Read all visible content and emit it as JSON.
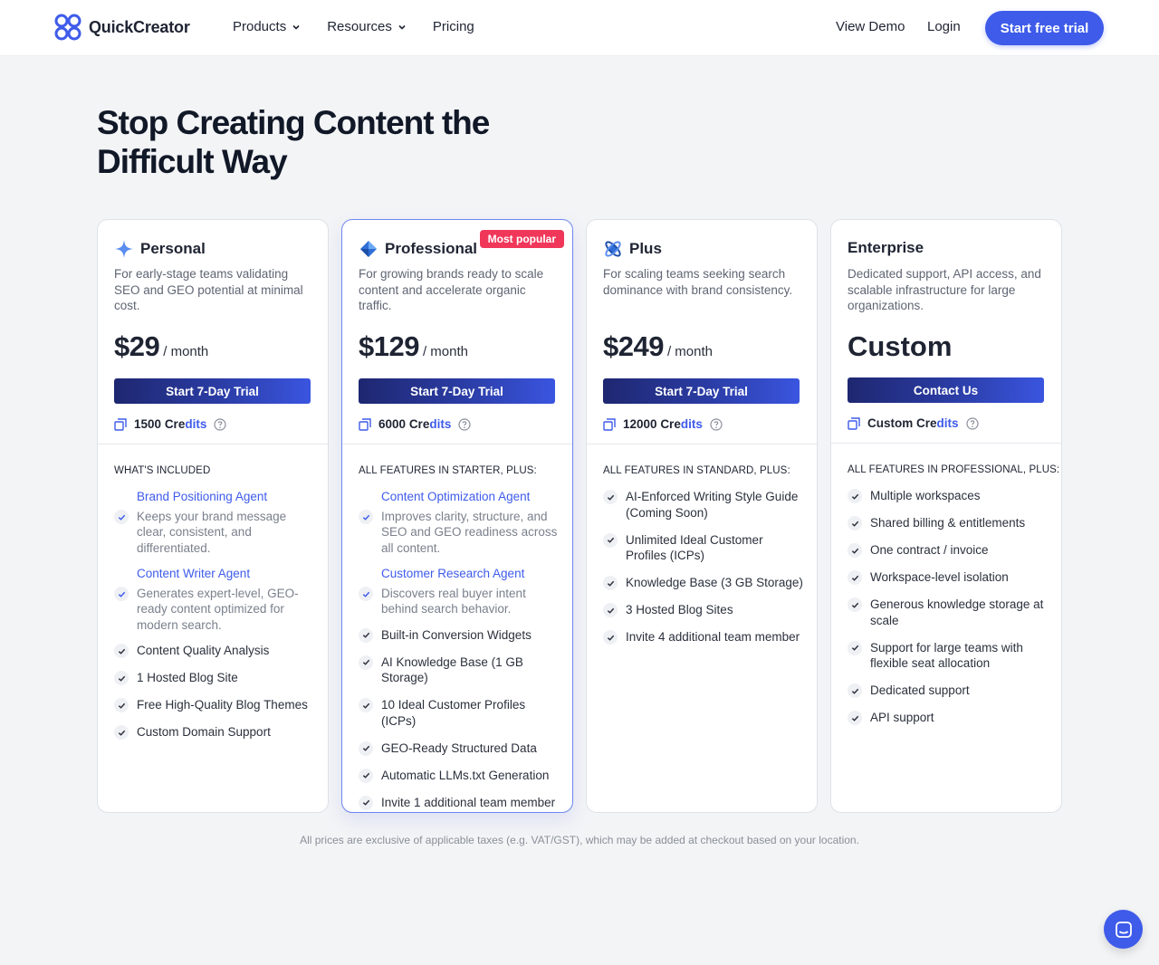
{
  "header": {
    "brand": "QuickCreator",
    "nav": [
      "Products",
      "Resources",
      "Pricing"
    ],
    "view_demo": "View Demo",
    "login": "Login",
    "cta": "Start free trial"
  },
  "hero": {
    "title_line1": "Stop Creating Content the",
    "title_line2": "Difficult Way"
  },
  "plans": [
    {
      "name": "Personal",
      "desc": "For early-stage teams validating SEO and GEO potential at minimal cost.",
      "price": "$29",
      "per": "/ month",
      "button": "Start 7-Day Trial",
      "credits_num": "1500",
      "credits_a": "Cre",
      "credits_b": "dits",
      "included": "WHAT'S INCLUDED",
      "agents": [
        {
          "title": "Brand Positioning Agent",
          "desc": "Keeps your brand message clear, consistent, and differentiated."
        },
        {
          "title": "Content Writer Agent",
          "desc": "Generates expert-level, GEO-ready content optimized for modern search."
        }
      ],
      "features": [
        "Content Quality Analysis",
        "1 Hosted Blog Site",
        "Free High-Quality Blog Themes",
        "Custom Domain Support"
      ]
    },
    {
      "name": "Professional",
      "badge": "Most popular",
      "desc": "For growing brands ready to scale content and accelerate organic traffic.",
      "price": "$129",
      "per": "/ month",
      "button": "Start 7-Day Trial",
      "credits_num": "6000",
      "credits_a": "Cre",
      "credits_b": "dits",
      "included": "ALL FEATURES IN STARTER, PLUS:",
      "agents": [
        {
          "title": "Content Optimization Agent",
          "desc": "Improves clarity, structure, and SEO and GEO readiness across all content."
        },
        {
          "title": "Customer Research Agent",
          "desc": "Discovers real buyer intent behind search behavior."
        }
      ],
      "features": [
        "Built-in Conversion Widgets",
        "AI Knowledge Base (1 GB Storage)",
        "10 Ideal Customer Profiles (ICPs)",
        "GEO-Ready Structured Data",
        "Automatic LLMs.txt Generation",
        "Invite 1 additional team member"
      ]
    },
    {
      "name": "Plus",
      "desc": "For scaling teams seeking search dominance with brand consistency.",
      "price": "$249",
      "per": "/ month",
      "button": "Start 7-Day Trial",
      "credits_num": "12000",
      "credits_a": "Cre",
      "credits_b": "dits",
      "included": "ALL FEATURES IN STANDARD, PLUS:",
      "features": [
        "AI-Enforced Writing Style Guide (Coming Soon)",
        "Unlimited Ideal Customer Profiles (ICPs)",
        "Knowledge Base (3 GB Storage)",
        "3 Hosted Blog Sites",
        "Invite 4 additional team member"
      ]
    },
    {
      "name": "Enterprise",
      "desc": "Dedicated support, API access, and scalable infrastructure for large organizations.",
      "price": "Custom",
      "button": "Contact Us",
      "credits_num": "Custom",
      "credits_a": "Cre",
      "credits_b": "dits",
      "included": "ALL FEATURES IN PROFESSIONAL, PLUS:",
      "features": [
        "Multiple workspaces",
        "Shared billing & entitlements",
        "One contract / invoice",
        "Workspace-level isolation",
        "Generous knowledge storage at scale",
        "Support for large teams with flexible seat allocation",
        "Dedicated support",
        "API support"
      ]
    }
  ],
  "footnote": "All prices are exclusive of applicable taxes (e.g. VAT/GST), which may be added at checkout based on your location.",
  "colors": {
    "accent": "#3e5bea",
    "badge": "#f0375a",
    "navy": "#1e2770"
  },
  "icons": {
    "logo": "quickcreator-logo-icon",
    "chat": "chat-icon"
  }
}
